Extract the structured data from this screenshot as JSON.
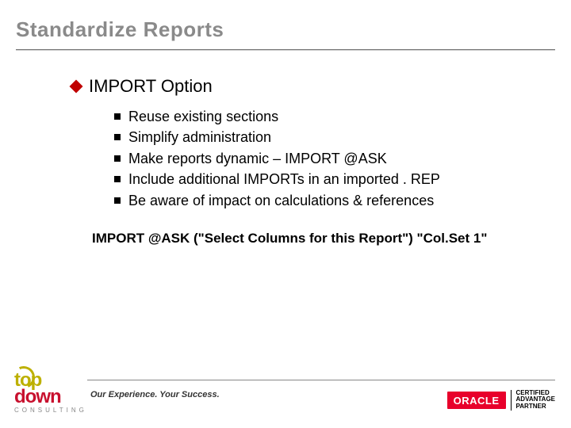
{
  "title": "Standardize Reports",
  "topic": "IMPORT Option",
  "bullets": [
    "Reuse existing sections",
    "Simplify administration",
    "Make reports dynamic – IMPORT @ASK",
    "Include additional IMPORTs in an imported . REP",
    "Be aware of impact on calculations & references"
  ],
  "code_example": "IMPORT @ASK (\"Select Columns for this Report\") \"Col.Set 1\"",
  "footer": {
    "tagline": "Our Experience. Your Success.",
    "left_logo": {
      "top_word": "top",
      "bottom_word": "down",
      "subtext": "CONSULTING"
    },
    "right_logo": {
      "brand": "ORACLE",
      "line1": "CERTIFIED",
      "line2": "ADVANTAGE",
      "line3": "PARTNER"
    }
  }
}
